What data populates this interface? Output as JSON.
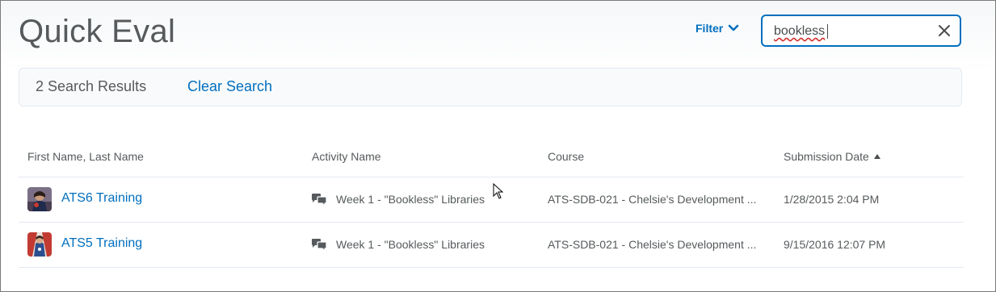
{
  "header": {
    "title": "Quick Eval",
    "filter_label": "Filter",
    "filter_icon": "chevron-down-icon"
  },
  "search": {
    "value": "bookless",
    "clear_icon": "close-icon"
  },
  "results_bar": {
    "count_text": "2 Search Results",
    "clear_label": "Clear Search"
  },
  "table": {
    "columns": [
      "First Name, Last Name",
      "Activity Name",
      "Course",
      "Submission Date"
    ],
    "sort_icon": "sort-ascending-icon",
    "rows": [
      {
        "name": "ATS6 Training",
        "activity": "Week 1 - \"Bookless\" Libraries",
        "activity_icon": "discussion-icon",
        "course": "ATS-SDB-021 - Chelsie's Development ...",
        "date": "1/28/2015 2:04 PM"
      },
      {
        "name": "ATS5 Training",
        "activity": "Week 1 - \"Bookless\" Libraries",
        "activity_icon": "discussion-icon",
        "course": "ATS-SDB-021 - Chelsie's Development ...",
        "date": "9/15/2016 12:07 PM"
      }
    ]
  },
  "colors": {
    "link": "#006fbf",
    "text": "#565a5c",
    "border": "#e3e9f1"
  }
}
